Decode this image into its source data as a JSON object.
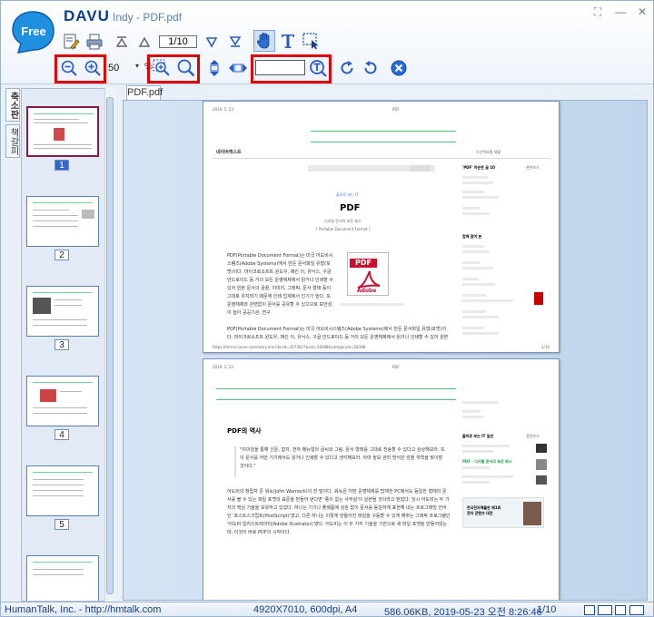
{
  "app": {
    "brand": "DAVU",
    "file_title": "Indy - PDF.pdf",
    "logo_text": "Free"
  },
  "window_buttons": [
    "restore-icon",
    "minimize-icon",
    "close-icon"
  ],
  "toolbar": {
    "page_field": "1/10",
    "zoom_value": "50",
    "zoom_unit": "%",
    "zoom_dropdown_glyph": "▾",
    "search_value": ""
  },
  "side_tabs": [
    "축소판",
    "책갈피"
  ],
  "thumbnails": [
    "1",
    "2",
    "3",
    "4",
    "5"
  ],
  "doc_tab": "PDF.pdf",
  "page1": {
    "date": "2019. 5. 23",
    "label": "PDF",
    "brand": "네이버캐스트",
    "nav_right": "두산백과홈  재활",
    "sub": "출처로 보는 IT",
    "title": "PDF",
    "subtitle": "디지털 문서의 표준 제시",
    "subtitle_en": "[ Portable Document Format ]",
    "side_heading": "'PDF' 하순한 글 10",
    "side_more": "관련보기",
    "side_heading2": "함께 참여 본",
    "adobe_icon_text": "PDF",
    "adobe_caption": "Adobe",
    "body": "PDF(Portable Document Format)는 미국 어도비시스템즈(Adobe Systems)에서 만든 문서파일 유형(포맷)이다. 마이크로소프트 윈도우, 매킨 이, 유닉스, 구글 안드로이드 등 거의 모든 운영체제에서 읽거나 인쇄할 수 있어 원본 문서의 글꼴, 이미지, 그래픽, 문서 형태 등이 그대로 유지되기 때문에 인쇄 업계에서 인기가 높다. 또 운영체제와 관련없이 문서를 공유할 수 있으므로 보안성이 높아 공공기관, 연구",
    "footer_url": "https://terms.naver.com/entry.nhn?docId=3573627&cid=58388&categoryId=58388",
    "footer_page": "1/10"
  },
  "page2": {
    "date": "2019. 5. 23",
    "label": "PDF",
    "section_title": "PDF의 역사",
    "quote": "\"이미징을 통해 신문, 잡지, 전자 매뉴얼의 글씨와 그림, 문서 형태를 그대로 전송할 수 있다고 상상해보라. 또 이 문서를 어떤 기기에서도 읽거나 인쇄할 수 있다고 생각해보라. 아마 정보 관리 방식은 엄청 개혁을 맞이할 것이다.\"",
    "body": "어도비의 창립자 존 워녹(John Warnock)의 한 말이다. 워녹은 어떤 운영체제를 탑재한 PC에서도 동일한 형태의 문서를 볼 수 있는 파일 포맷의 표준을 만들어 낸다면 '종이 없는 사무실'이 실현될 것이라고 믿었다. 당시 어도비는 두 가지의 핵심 기술을 보유하고 있었다. 하나는 기기나 플랫폼에 상관 없이 문서를 동일하게 표현해 내는 프로그래밍 언어인 '포스트스크립트(PostScript)'였고, 다른 하나는 이렇게 만들어진 파일을 구동할 수 있게 해주는 그래픽 프로그램인 '어도비 일러스트레이터(Adobe Illustrator)'였다. 어도비는 이 두 가지 기술을 기반으로 새 파일 포맷을 만들어냈는데, 이것이 바로 PDF의 시작이다.",
    "side_heading": "출처로 보는 IT 일반",
    "side_more": "관련보기",
    "side_item": "PDF - 디지털 문서의 표준 제시",
    "ad_text": "한국전자책출판 제1회\n전자 콘텐츠 대전"
  },
  "status": {
    "company": "HumanTalk, Inc. - http://hmtalk.com",
    "dimensions": "4920X7010, 600dpi, A4",
    "file_info": "586.06KB, 2019-05-23 오전 8:26:46",
    "page": "1/10"
  },
  "colors": {
    "accent_red": "#e00000",
    "brand_blue": "#0d3f8c",
    "status_text": "#1b3f86",
    "logo_blue": "#1f8fe0"
  }
}
